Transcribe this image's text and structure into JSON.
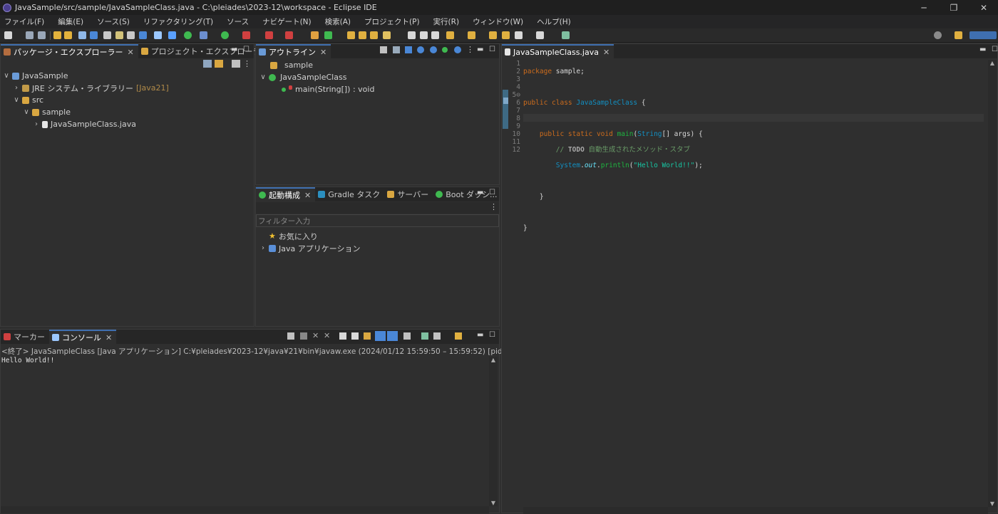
{
  "window": {
    "title": "JavaSample/src/sample/JavaSampleClass.java - C:\\pleiades\\2023-12\\workspace - Eclipse IDE",
    "minimize": "─",
    "restore": "❐",
    "close": "✕"
  },
  "menu": [
    "ファイル(F)",
    "編集(E)",
    "ソース(S)",
    "リファクタリング(T)",
    "ソース",
    "ナビゲート(N)",
    "検索(A)",
    "プロジェクト(P)",
    "実行(R)",
    "ウィンドウ(W)",
    "ヘルプ(H)"
  ],
  "package_explorer": {
    "tabs": [
      "パッケージ・エクスプローラー",
      "プロジェクト・エクスプローラー"
    ],
    "tree": [
      {
        "label": "JavaSample",
        "chevron": "∨"
      },
      {
        "label": "JRE システム・ライブラリー",
        "suffix": "[Java21]",
        "chevron": "›"
      },
      {
        "label": "src",
        "chevron": "∨"
      },
      {
        "label": "sample",
        "chevron": "∨"
      },
      {
        "label": "JavaSampleClass.java",
        "chevron": "›"
      }
    ]
  },
  "outline": {
    "tab": "アウトライン",
    "tree": [
      {
        "label": "sample"
      },
      {
        "label": "JavaSampleClass",
        "chevron": "∨"
      },
      {
        "label": "main(String[]) : void"
      }
    ]
  },
  "launch": {
    "tabs": [
      "起動構成",
      "Gradle タスク",
      "サーバー",
      "Boot ダッシ..."
    ],
    "filter_placeholder": "フィルター入力",
    "tree": [
      {
        "label": "お気に入り"
      },
      {
        "label": "Java アプリケーション",
        "chevron": "›"
      }
    ]
  },
  "console": {
    "tabs": [
      "マーカー",
      "コンソール"
    ],
    "header": "<終了> JavaSampleClass [Java アプリケーション] C:¥pleiades¥2023-12¥java¥21¥bin¥javaw.exe  (2024/01/12 15:59:50 – 15:59:52) [pid: 4608]",
    "output": "Hello World!!"
  },
  "editor": {
    "tab": "JavaSampleClass.java",
    "line_numbers": [
      "1",
      "2",
      "3",
      "4",
      "5⊖",
      "6",
      "7",
      "8",
      "9",
      "10",
      "11",
      "12"
    ],
    "code": {
      "l1a": "package",
      "l1b": " sample;",
      "l3a": "public class ",
      "l3b": "JavaSampleClass",
      " l3c": " {",
      "l5a": "    public static void ",
      "l5b": "main",
      "l5c": "(",
      "l5d": "String",
      "l5e": "[] args) {",
      "l6a": "        // ",
      "l6b": "TODO",
      "l6c": " 自動生成されたメソッド・スタブ",
      "l7a": "        ",
      "l7b": "System",
      "l7c": ".",
      "l7d": "out",
      "l7e": ".",
      "l7f": "println",
      "l7g": "(",
      "l7h": "\"Hello World!!\"",
      "l7i": ");",
      "l9": "    }",
      "l11": "}"
    }
  },
  "colors": {
    "accent": "#3f6fb0",
    "keyword": "#cc6c1d",
    "class": "#1290c3",
    "string": "#17c6a3",
    "comment": "#6a9c68"
  }
}
